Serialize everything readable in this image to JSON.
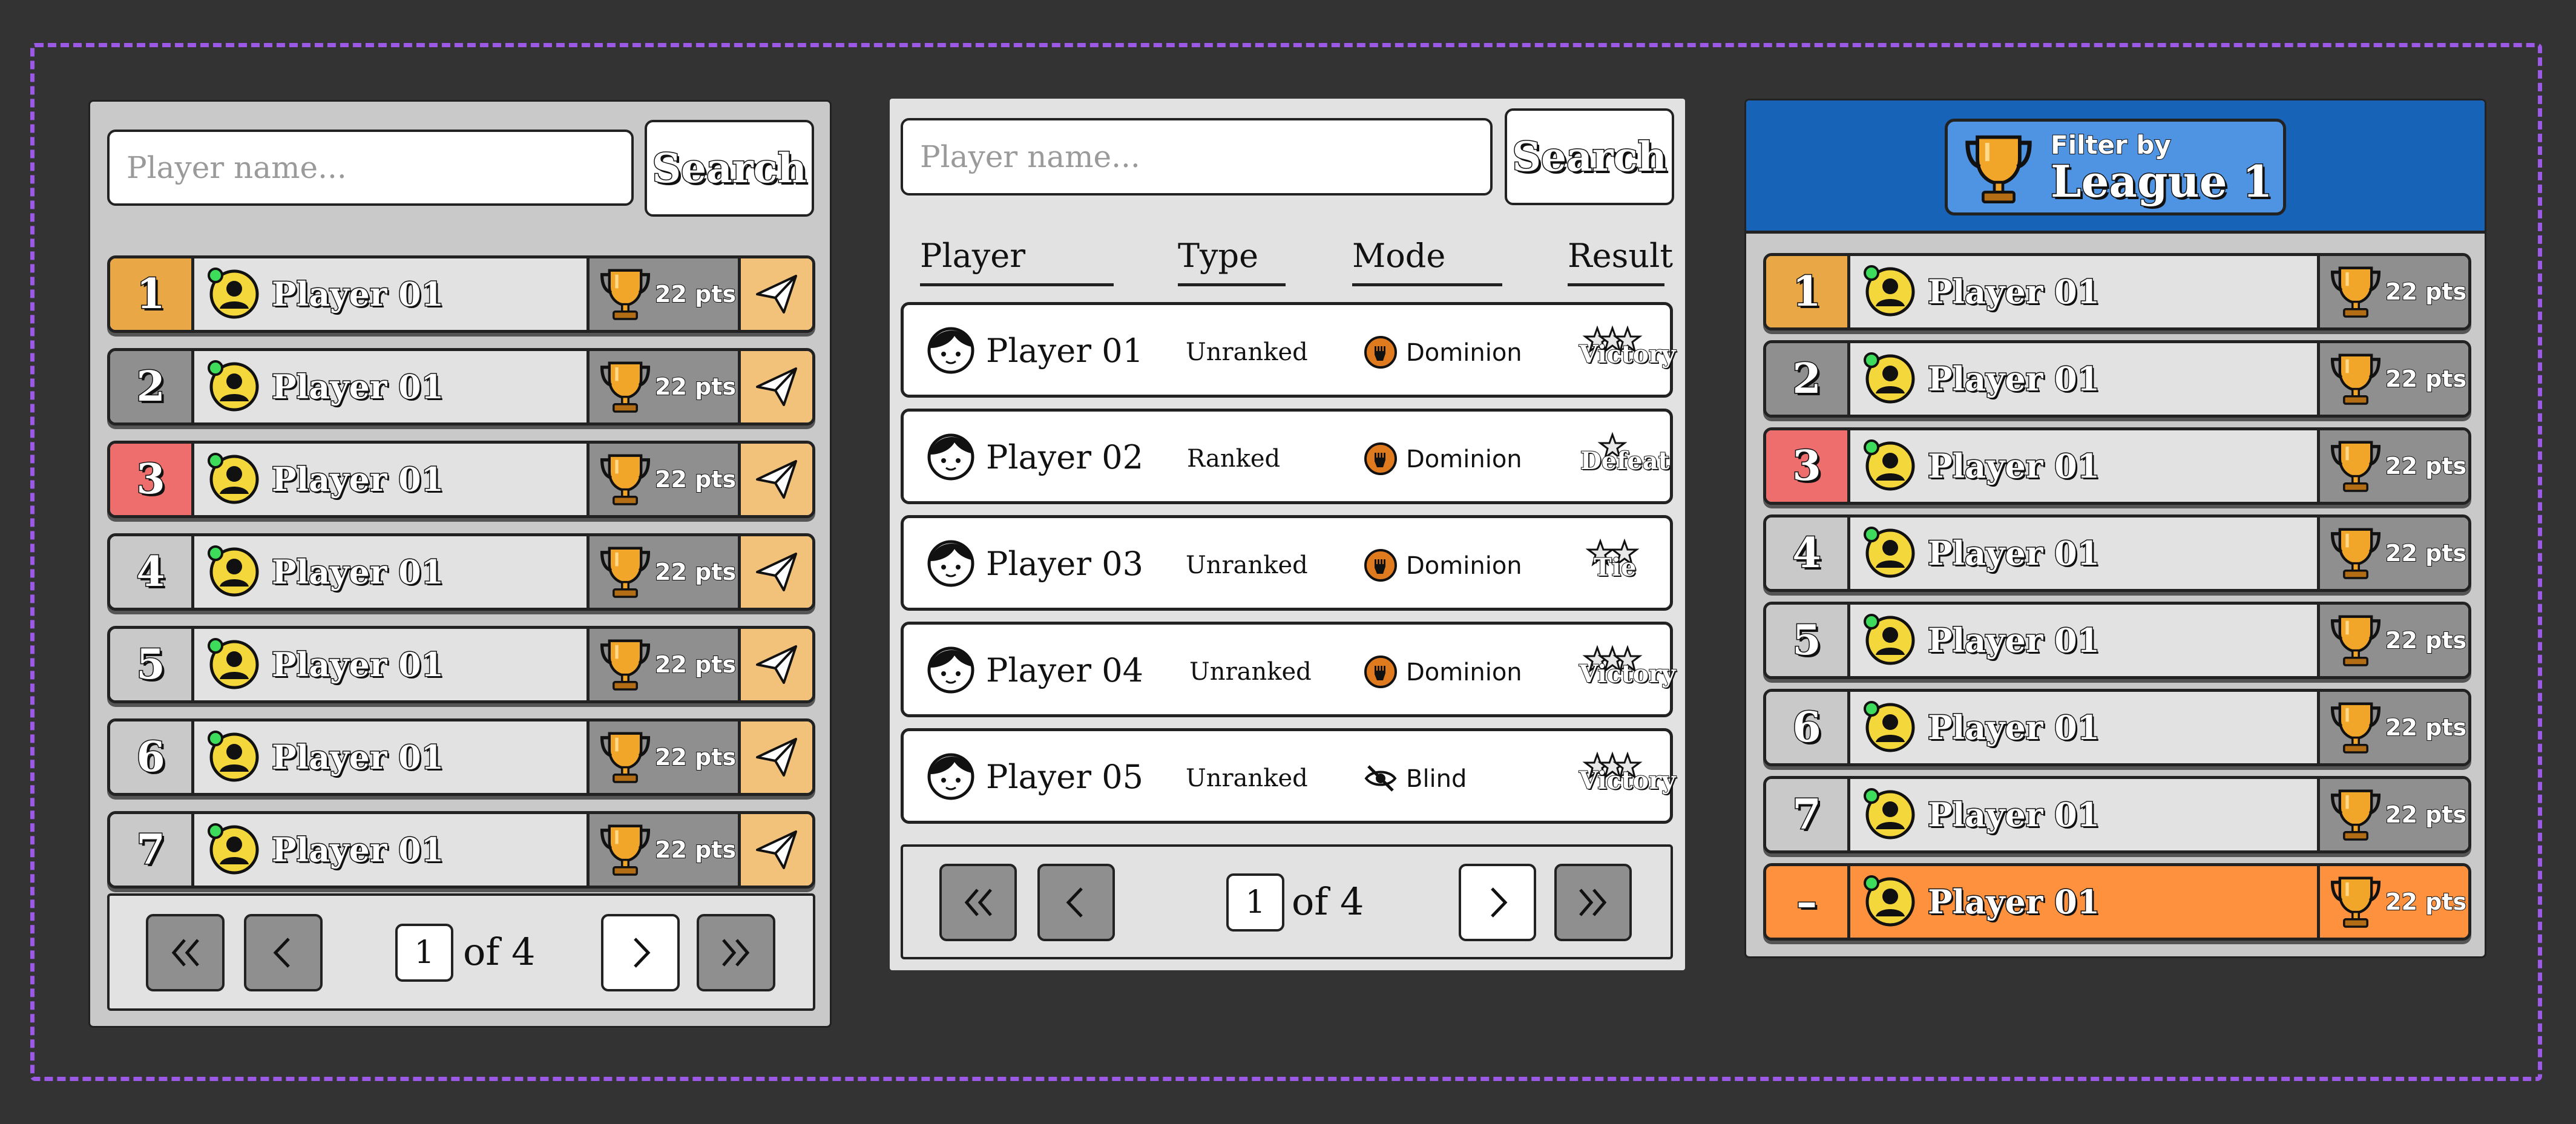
{
  "colors": {
    "rank1": "#e9a745",
    "rank2": "#8f8f8f",
    "rank3": "#ee6e6e",
    "rank_default": "#c9c9c9",
    "self_row": "#fd913e",
    "send_cell": "#f2c27a",
    "header_blue": "#1763b8",
    "filter_blue": "#4f93e3",
    "dashed_border": "#9b59e6"
  },
  "left_panel": {
    "search_placeholder": "Player name...",
    "search_label": "Search",
    "rows": [
      {
        "rank": "1",
        "name": "Player 01",
        "points": "22 pts",
        "rank_color": "#e9a745"
      },
      {
        "rank": "2",
        "name": "Player 01",
        "points": "22 pts",
        "rank_color": "#8f8f8f"
      },
      {
        "rank": "3",
        "name": "Player 01",
        "points": "22 pts",
        "rank_color": "#ee6e6e"
      },
      {
        "rank": "4",
        "name": "Player 01",
        "points": "22 pts",
        "rank_color": "#c9c9c9"
      },
      {
        "rank": "5",
        "name": "Player 01",
        "points": "22 pts",
        "rank_color": "#c9c9c9"
      },
      {
        "rank": "6",
        "name": "Player 01",
        "points": "22 pts",
        "rank_color": "#c9c9c9"
      },
      {
        "rank": "7",
        "name": "Player 01",
        "points": "22 pts",
        "rank_color": "#c9c9c9"
      }
    ],
    "pager": {
      "page": "1",
      "of_label": "of 4"
    }
  },
  "middle_panel": {
    "search_placeholder": "Player name...",
    "search_label": "Search",
    "columns": {
      "player": "Player",
      "type": "Type",
      "mode": "Mode",
      "result": "Result"
    },
    "matches": [
      {
        "name": "Player 01",
        "type": "Unranked",
        "mode": "Dominion",
        "mode_icon": "fist-icon",
        "result": "Victory",
        "stars": 3
      },
      {
        "name": "Player 02",
        "type": "Ranked",
        "mode": "Dominion",
        "mode_icon": "fist-icon",
        "result": "Defeat",
        "stars": 1
      },
      {
        "name": "Player 03",
        "type": "Unranked",
        "mode": "Dominion",
        "mode_icon": "fist-icon",
        "result": "Tie",
        "stars": 2
      },
      {
        "name": "Player 04",
        "type": "Unranked",
        "mode": "Dominion",
        "mode_icon": "fist-icon",
        "result": "Victory",
        "stars": 3
      },
      {
        "name": "Player 05",
        "type": "Unranked",
        "mode": "Blind",
        "mode_icon": "eye-slash-icon",
        "result": "Victory",
        "stars": 3
      }
    ],
    "pager": {
      "page": "1",
      "of_label": "of 4"
    }
  },
  "right_panel": {
    "filter_small": "Filter by",
    "filter_big": "League 1",
    "rows": [
      {
        "rank": "1",
        "name": "Player 01",
        "points": "22 pts",
        "rank_color": "#e9a745"
      },
      {
        "rank": "2",
        "name": "Player 01",
        "points": "22 pts",
        "rank_color": "#8f8f8f"
      },
      {
        "rank": "3",
        "name": "Player 01",
        "points": "22 pts",
        "rank_color": "#ee6e6e"
      },
      {
        "rank": "4",
        "name": "Player 01",
        "points": "22 pts",
        "rank_color": "#c9c9c9"
      },
      {
        "rank": "5",
        "name": "Player 01",
        "points": "22 pts",
        "rank_color": "#c9c9c9"
      },
      {
        "rank": "6",
        "name": "Player 01",
        "points": "22 pts",
        "rank_color": "#c9c9c9"
      },
      {
        "rank": "7",
        "name": "Player 01",
        "points": "22 pts",
        "rank_color": "#c9c9c9"
      }
    ],
    "self_row": {
      "rank": "–",
      "name": "Player 01",
      "points": "22 pts"
    }
  }
}
